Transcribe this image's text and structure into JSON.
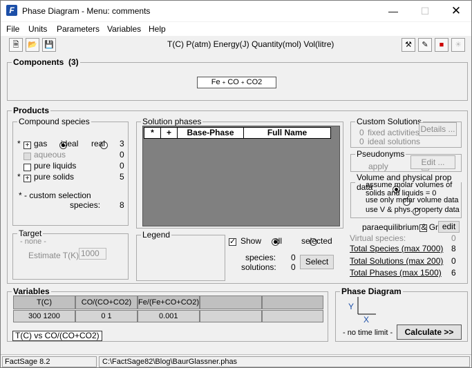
{
  "window": {
    "title": "Phase Diagram - Menu: comments",
    "app_icon": "F"
  },
  "menu": [
    "File",
    "Units",
    "Parameters",
    "Variables",
    "Help"
  ],
  "units_text": "T(C)  P(atm)  Energy(J)  Quantity(mol)  Vol(litre)",
  "components": {
    "title": "Components",
    "count": "(3)",
    "formula": [
      "Fe",
      "+",
      "CO",
      "+",
      "CO2"
    ]
  },
  "products": {
    "title": "Products"
  },
  "compound_species": {
    "title": "Compound species",
    "rows": [
      {
        "star": "*",
        "check": "+",
        "label": "gas",
        "count": "3"
      },
      {
        "star": "",
        "check": "",
        "label": "aqueous",
        "count": "0"
      },
      {
        "star": "",
        "check": "",
        "label": "pure liquids",
        "count": "0"
      },
      {
        "star": "*",
        "check": "+",
        "label": "pure solids",
        "count": "5"
      }
    ],
    "ideal": "ideal",
    "real": "real",
    "custom_note": "* - custom selection",
    "species_label": "species:",
    "species_count": "8"
  },
  "target": {
    "title": "Target",
    "none": "- none -",
    "estimate_label": "Estimate T(K):",
    "estimate_value": "1000"
  },
  "solution_phases": {
    "title": "Solution phases",
    "cols": [
      "*",
      "+",
      "Base-Phase",
      "Full Name"
    ]
  },
  "legend": {
    "title": "Legend",
    "show": "Show",
    "all": "all",
    "selected": "selected",
    "species_label": "species:",
    "species_value": "0",
    "solutions_label": "solutions:",
    "solutions_value": "0",
    "select_button": "Select"
  },
  "custom_solutions": {
    "title": "Custom Solutions",
    "fixed_count": "0",
    "fixed_label": "fixed activities",
    "ideal_count": "0",
    "ideal_label": "ideal solutions",
    "details_button": "Details ..."
  },
  "pseudonyms": {
    "title": "Pseudonyms",
    "apply": "apply",
    "edit_button": "Edit ..."
  },
  "volume": {
    "title": "Volume and physical prop data",
    "options": [
      "assume molar volumes of solids and liquids = 0",
      "use only molar volume data",
      "use V & phys. property data"
    ]
  },
  "paraequilibrium": {
    "label": "paraequilibrium & Gmin",
    "edit_button": "edit"
  },
  "totals": {
    "virtual_label": "Virtual species:",
    "virtual_value": "0",
    "rows": [
      {
        "label": "Total Species (max 7000)",
        "value": "8"
      },
      {
        "label": "Total Solutions (max 200)",
        "value": "0"
      },
      {
        "label": "Total Phases (max 1500)",
        "value": "6"
      }
    ]
  },
  "variables": {
    "title": "Variables",
    "headers": [
      "T(C)",
      "CO/(CO+CO2)",
      "Fe/(Fe+CO+CO2)",
      "",
      ""
    ],
    "values": [
      "300 1200",
      "0 1",
      "0.001",
      "",
      ""
    ],
    "axes_label": "T(C)  vs  CO/(CO+CO2)"
  },
  "phase_diagram": {
    "title": "Phase Diagram",
    "y_axis": "Y",
    "x_axis": "X",
    "time_limit": "- no time limit -",
    "calculate_button": "Calculate >>"
  },
  "status": {
    "version": "FactSage 8.2",
    "path": "C:\\FactSage82\\Blog\\BaurGlassner.phas"
  }
}
